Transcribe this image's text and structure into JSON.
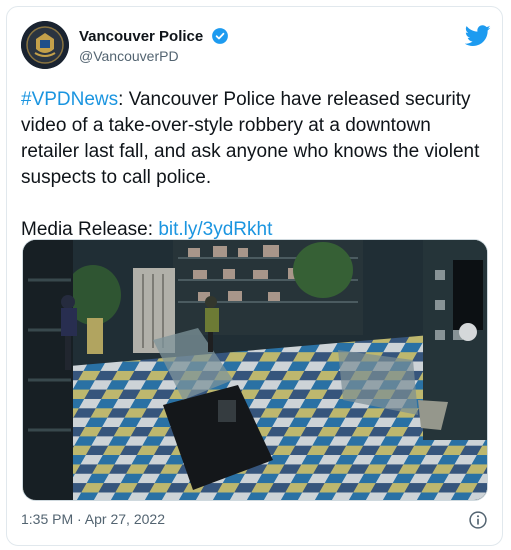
{
  "tweet": {
    "display_name": "Vancouver Police",
    "handle": "@VancouverPD",
    "hashtag": "#VPDNews",
    "body": ": Vancouver Police have released security video of a take-over-style robbery at a downtown retailer last fall, and ask anyone who knows the violent suspects to call police.",
    "media_release_label": "Media Release:",
    "media_release_link": "bit.ly/3ydRkht",
    "timestamp": "1:35 PM · Apr 27, 2022"
  },
  "colors": {
    "link": "#1b95e0",
    "verified": "#1d9bf0",
    "brand": "#1d9bf0"
  },
  "icons": {
    "verified": "verified-badge-icon",
    "brand": "twitter-bird-icon",
    "info": "info-icon"
  }
}
